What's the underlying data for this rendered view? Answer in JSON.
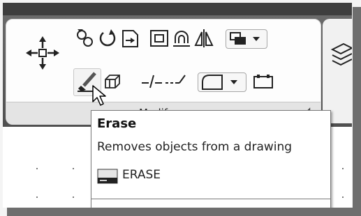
{
  "ribbon": {
    "panel_title": "Modify",
    "expand_icon": "panel-expand-arrow-icon",
    "tools_row1": [
      "copy-icon",
      "rotate-icon",
      "trim-icon",
      "offset-icon",
      "array-icon",
      "mirror-icon",
      "draworder-icon"
    ],
    "tools_row2": [
      "erase-icon",
      "explode-icon",
      "break-icon",
      "join-icon",
      "fillet-icon",
      "stretch-icon"
    ],
    "move_tool": "move-icon"
  },
  "tooltip": {
    "title": "Erase",
    "description": "Removes objects from a drawing",
    "command": "ERASE",
    "command_icon": "command-line-icon"
  }
}
